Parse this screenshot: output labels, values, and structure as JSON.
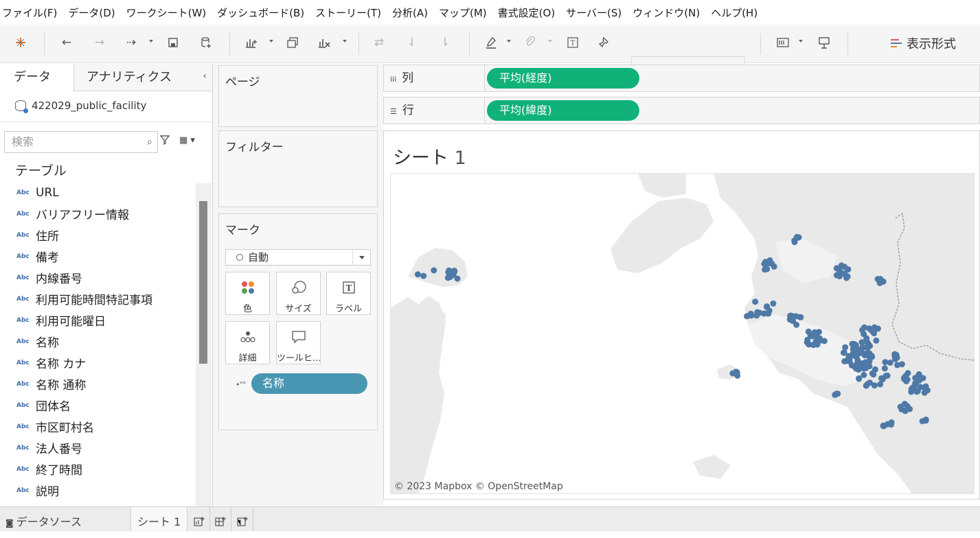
{
  "menu": [
    "ファイル(F)",
    "データ(D)",
    "ワークシート(W)",
    "ダッシュボード(B)",
    "ストーリー(T)",
    "分析(A)",
    "マップ(M)",
    "書式設定(O)",
    "サーバー(S)",
    "ウィンドウ(N)",
    "ヘルプ(H)"
  ],
  "toolbar": {
    "show_me_label": "表示形式",
    "icons": [
      "tableau-logo-icon",
      "undo-icon",
      "redo-icon",
      "replay-icon",
      "save-icon",
      "new-datasource-icon",
      "new-worksheet-icon",
      "duplicate-icon",
      "clear-sheet-icon",
      "swap-icon",
      "sort-ascending-icon",
      "sort-descending-icon",
      "highlight-icon",
      "group-icon",
      "show-labels-icon",
      "fix-axes-icon",
      "fit-dropdown",
      "show-cards-icon",
      "presentation-icon"
    ]
  },
  "left_pane": {
    "tabs": [
      "データ",
      "アナリティクス"
    ],
    "datasource": "422029_public_facility",
    "search_placeholder": "検索",
    "tables_heading": "テーブル",
    "field_type_label": "Abc",
    "fields": [
      "URL",
      "バリアフリー情報",
      "住所",
      "備考",
      "内線番号",
      "利用可能時間特記事項",
      "利用可能曜日",
      "名称",
      "名称 カナ",
      "名称 通称",
      "団体名",
      "市区町村名",
      "法人番号",
      "終了時間",
      "説明"
    ]
  },
  "cards": {
    "pages": "ページ",
    "filters": "フィルター",
    "marks": "マーク",
    "mark_type": "自動",
    "buttons": [
      "色",
      "サイズ",
      "ラベル",
      "詳細",
      "ツールヒ…"
    ],
    "detail_pill": "名称"
  },
  "shelves": {
    "columns_label": "列",
    "columns_pill": "平均(経度)",
    "rows_label": "行",
    "rows_pill": "平均(緯度)"
  },
  "view": {
    "sheet_title": "シート",
    "sheet_number": "1",
    "attribution": "© 2023 Mapbox © OpenStreetMap",
    "mark_color": "#4e79a7",
    "point_count": 220
  },
  "bottom": {
    "datasource_tab": "データソース",
    "sheet_tab": "シート 1"
  }
}
